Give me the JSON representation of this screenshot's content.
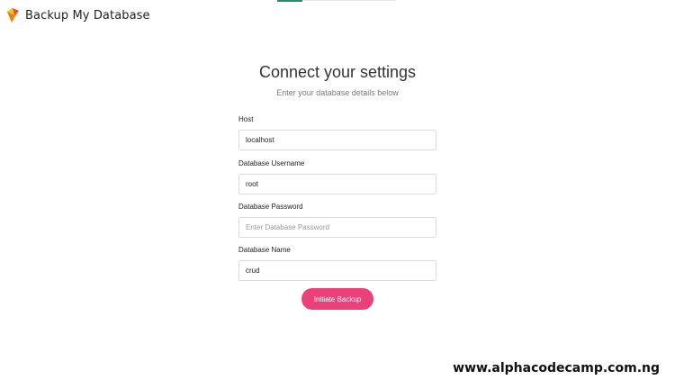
{
  "app": {
    "title": "Backup My Database",
    "logo_icon": "gem-icon",
    "accent_color": "#ec407a"
  },
  "form": {
    "heading": "Connect your settings",
    "subheading": "Enter your database details below",
    "fields": [
      {
        "label": "Host",
        "value": "localhost",
        "placeholder": ""
      },
      {
        "label": "Database Username",
        "value": "root",
        "placeholder": ""
      },
      {
        "label": "Database Password",
        "value": "",
        "placeholder": "Enter Database Password"
      },
      {
        "label": "Database Name",
        "value": "crud",
        "placeholder": ""
      }
    ],
    "submit_label": "Initiate Backup"
  },
  "watermark": "www.alphacodecamp.com.ng"
}
